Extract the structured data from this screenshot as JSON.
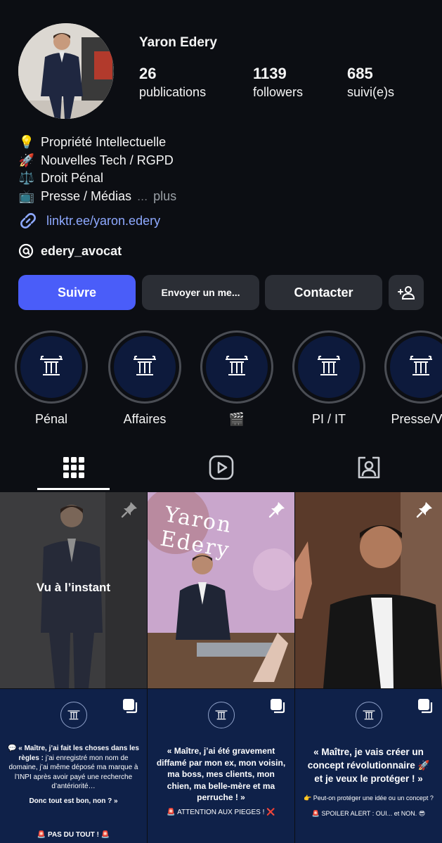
{
  "profile": {
    "name": "Yaron Edery",
    "stats": [
      {
        "value": "26",
        "label": "publications"
      },
      {
        "value": "1139",
        "label": "followers"
      },
      {
        "value": "685",
        "label": "suivi(e)s"
      }
    ],
    "bio": [
      {
        "emoji": "💡",
        "text": "Propriété Intellectuelle"
      },
      {
        "emoji": "🚀",
        "text": "Nouvelles Tech / RGPD"
      },
      {
        "emoji": "⚖️",
        "text": "Droit Pénal"
      },
      {
        "emoji": "📺",
        "text": "Presse / Médias"
      }
    ],
    "ellipsis": "...",
    "more_label": "plus",
    "link": "linktr.ee/yaron.edery",
    "threads_handle": "edery_avocat"
  },
  "actions": {
    "follow": "Suivre",
    "message": "Envoyer un me...",
    "contact": "Contacter"
  },
  "highlights": [
    {
      "label": "Pénal"
    },
    {
      "label": "Affaires"
    },
    {
      "label": "🎬"
    },
    {
      "label": "PI / IT"
    },
    {
      "label": "Presse/VP"
    }
  ],
  "tabs": [
    "grid-icon",
    "reels-icon",
    "tagged-icon"
  ],
  "posts": {
    "first_overlay": "Vu à l’instant",
    "second_watermark": "Yaron Edery",
    "bottom": [
      {
        "quote_intro": "💬 « Maître, j’ai fait les choses dans les règles :",
        "quote_body": " j’ai enregistré mon nom de domaine, j’ai même déposé ma marque à l’INPI après avoir payé une recherche d’antériorité…",
        "question": "Donc tout est bon, non ? »",
        "footer": "🚨 PAS DU TOUT ! 🚨"
      },
      {
        "quote": "« Maître, j’ai été gravement diffamé par mon ex, mon voisin, ma boss, mes clients, mon chien, ma belle-mère et ma perruche ! »",
        "footer": "🚨 ATTENTION AUX PIEGES ! ❌"
      },
      {
        "quote": "« Maître, je vais créer un concept révolutionnaire 🚀 et je veux le protéger ! »",
        "sub": "👉 Peut-on protéger une idée ou un concept ?",
        "footer": "🚨 SPOILER ALERT : OUI... et NON. 😎"
      }
    ]
  },
  "colors": {
    "background": "#0c0e13",
    "primary_button": "#4a5df9",
    "secondary_button": "#2b2e35",
    "link": "#8ea9ff",
    "highlight_bg": "#0d1a3c",
    "post_bottom_bg": "#0f2149"
  }
}
